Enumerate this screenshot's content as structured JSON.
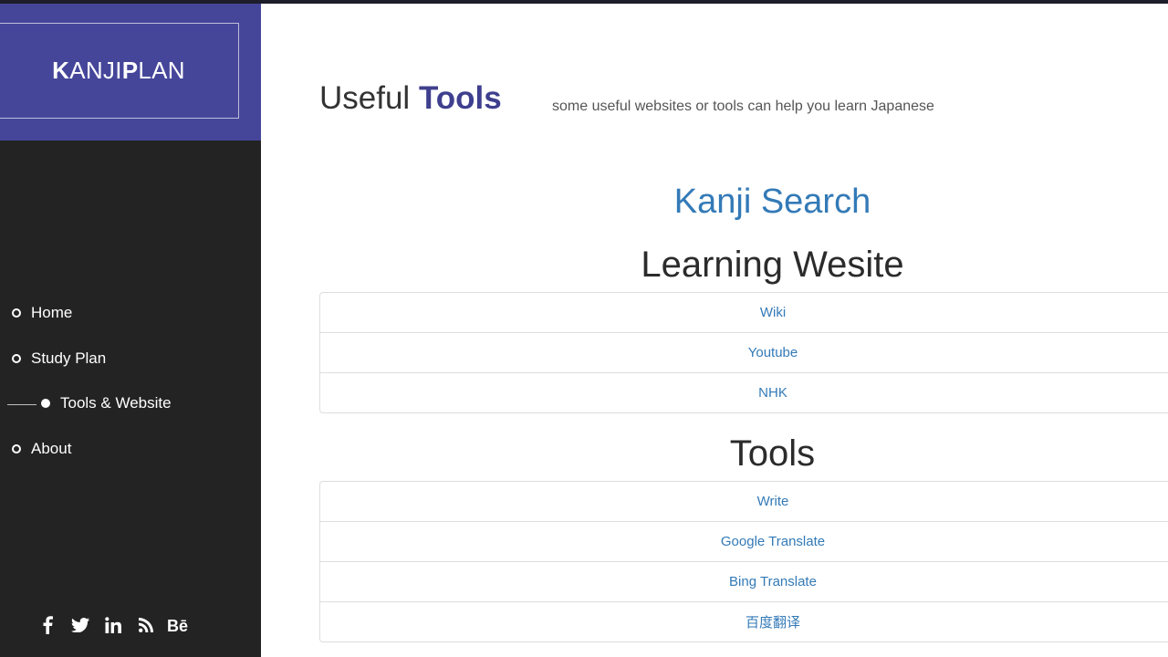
{
  "brand": {
    "k": "K",
    "anji": "ANJI",
    "p": "P",
    "lan": "LAN"
  },
  "nav": {
    "items": [
      {
        "label": "Home"
      },
      {
        "label": "Study Plan"
      },
      {
        "label": "Tools & Website"
      },
      {
        "label": "About"
      }
    ]
  },
  "social": [
    "facebook-icon",
    "twitter-icon",
    "linkedin-icon",
    "rss-icon",
    "behance-icon"
  ],
  "header": {
    "title_plain": "Useful",
    "title_highlight": "Tools",
    "subtitle": "some useful websites or tools can help you learn Japanese"
  },
  "kanji_search": "Kanji Search",
  "learning": {
    "heading": "Learning Wesite",
    "links": [
      "Wiki",
      "Youtube",
      "NHK"
    ]
  },
  "tools": {
    "heading": "Tools",
    "links": [
      "Write",
      "Google Translate",
      "Bing Translate",
      "百度翻译"
    ]
  },
  "colors": {
    "accent": "#45469a",
    "sidebar": "#232323",
    "link": "#337ab7"
  }
}
